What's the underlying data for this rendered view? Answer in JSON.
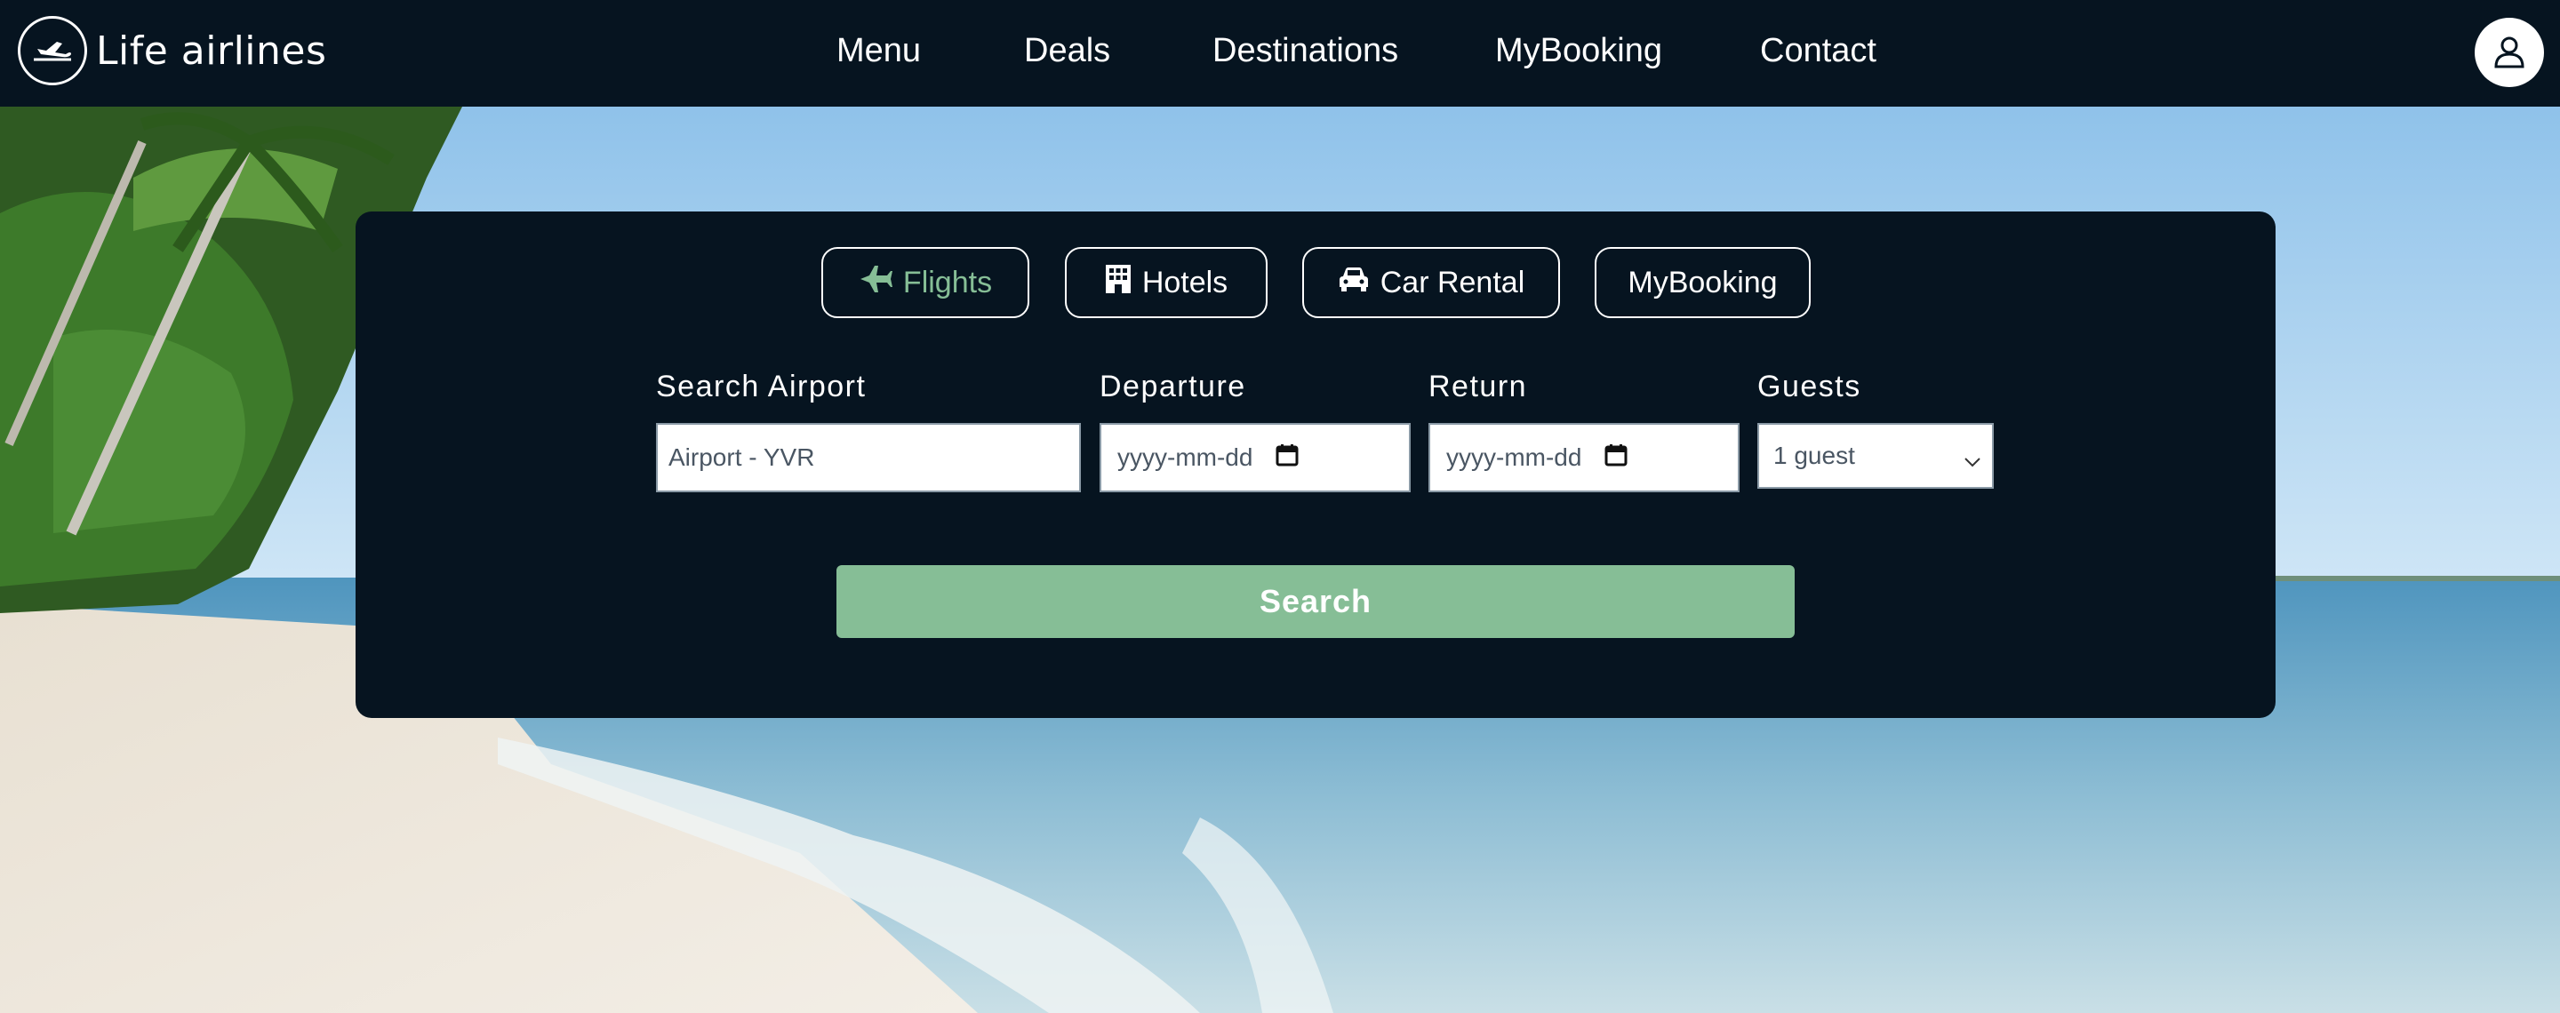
{
  "brand": {
    "name": "Life airlines",
    "logo_icon": "plane-takeoff-icon"
  },
  "nav": {
    "links": [
      "Menu",
      "Deals",
      "Destinations",
      "MyBooking",
      "Contact"
    ],
    "account_icon": "user-icon"
  },
  "search_panel": {
    "tabs": [
      {
        "label": "Flights",
        "icon": "plane-icon",
        "active": true
      },
      {
        "label": "Hotels",
        "icon": "hotel-icon",
        "active": false
      },
      {
        "label": "Car Rental",
        "icon": "car-icon",
        "active": false
      },
      {
        "label": "MyBooking",
        "icon": "",
        "active": false
      }
    ],
    "fields": {
      "airport": {
        "label": "Search Airport",
        "placeholder": "Airport - YVR"
      },
      "departure": {
        "label": "Departure",
        "value": "yyyy-mm-dd"
      },
      "return": {
        "label": "Return",
        "value": "yyyy-mm-dd"
      },
      "guests": {
        "label": "Guests",
        "selected": "1 guest"
      }
    },
    "search_label": "Search"
  },
  "colors": {
    "nav_bg": "#061420",
    "panel_bg": "#061420",
    "accent": "#86be96",
    "text": "#ffffff"
  }
}
